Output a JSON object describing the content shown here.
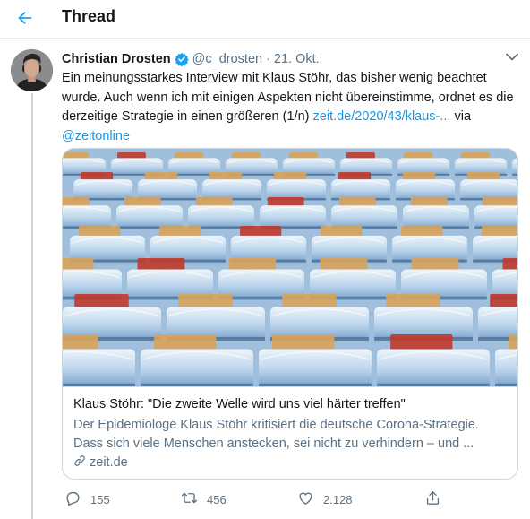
{
  "header": {
    "title": "Thread"
  },
  "tweet": {
    "author_name": "Christian Drosten",
    "handle": "@c_drosten",
    "separator": "·",
    "date": "21. Okt.",
    "text_1": "Ein meinungsstarkes Interview mit Klaus Stöhr, das bisher wenig beachtet wurde. Auch wenn ich mit einigen Aspekten nicht übereinstimme, ordnet es die derzeitige Strategie in einen größeren (1/n) ",
    "link_text": "zeit.de/2020/43/klaus-...",
    "text_2": " via ",
    "mention": "@zeitonline"
  },
  "card": {
    "title": "Klaus Stöhr: \"Die zweite Welle wird uns viel härter treffen\"",
    "description": "Der Epidemiologe Klaus Stöhr kritisiert die deutsche Corona-Strategie. Dass sich viele Menschen anstecken, sei nicht zu verhindern – und ...",
    "domain": "zeit.de"
  },
  "actions": {
    "replies": "155",
    "retweets": "456",
    "likes": "2.128"
  },
  "colors": {
    "accent": "#1da1f2",
    "link": "#1b95e0",
    "muted": "#5b7083",
    "text": "#14171a",
    "border": "#ccd6dd"
  },
  "icons": [
    "back-arrow-icon",
    "verified-icon",
    "chevron-down-icon",
    "link-icon",
    "reply-icon",
    "retweet-icon",
    "like-icon",
    "share-icon"
  ]
}
